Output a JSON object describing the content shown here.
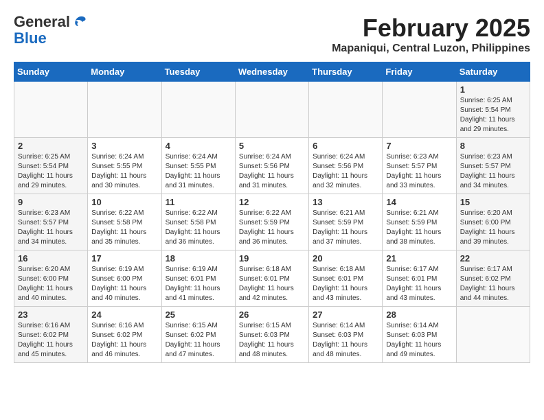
{
  "header": {
    "logo_line1": "General",
    "logo_line2": "Blue",
    "month_year": "February 2025",
    "location": "Mapaniqui, Central Luzon, Philippines"
  },
  "days_of_week": [
    "Sunday",
    "Monday",
    "Tuesday",
    "Wednesday",
    "Thursday",
    "Friday",
    "Saturday"
  ],
  "weeks": [
    [
      {
        "day": "",
        "info": ""
      },
      {
        "day": "",
        "info": ""
      },
      {
        "day": "",
        "info": ""
      },
      {
        "day": "",
        "info": ""
      },
      {
        "day": "",
        "info": ""
      },
      {
        "day": "",
        "info": ""
      },
      {
        "day": "1",
        "info": "Sunrise: 6:25 AM\nSunset: 5:54 PM\nDaylight: 11 hours\nand 29 minutes."
      }
    ],
    [
      {
        "day": "2",
        "info": "Sunrise: 6:25 AM\nSunset: 5:54 PM\nDaylight: 11 hours\nand 29 minutes."
      },
      {
        "day": "3",
        "info": "Sunrise: 6:24 AM\nSunset: 5:55 PM\nDaylight: 11 hours\nand 30 minutes."
      },
      {
        "day": "4",
        "info": "Sunrise: 6:24 AM\nSunset: 5:55 PM\nDaylight: 11 hours\nand 31 minutes."
      },
      {
        "day": "5",
        "info": "Sunrise: 6:24 AM\nSunset: 5:56 PM\nDaylight: 11 hours\nand 31 minutes."
      },
      {
        "day": "6",
        "info": "Sunrise: 6:24 AM\nSunset: 5:56 PM\nDaylight: 11 hours\nand 32 minutes."
      },
      {
        "day": "7",
        "info": "Sunrise: 6:23 AM\nSunset: 5:57 PM\nDaylight: 11 hours\nand 33 minutes."
      },
      {
        "day": "8",
        "info": "Sunrise: 6:23 AM\nSunset: 5:57 PM\nDaylight: 11 hours\nand 34 minutes."
      }
    ],
    [
      {
        "day": "9",
        "info": "Sunrise: 6:23 AM\nSunset: 5:57 PM\nDaylight: 11 hours\nand 34 minutes."
      },
      {
        "day": "10",
        "info": "Sunrise: 6:22 AM\nSunset: 5:58 PM\nDaylight: 11 hours\nand 35 minutes."
      },
      {
        "day": "11",
        "info": "Sunrise: 6:22 AM\nSunset: 5:58 PM\nDaylight: 11 hours\nand 36 minutes."
      },
      {
        "day": "12",
        "info": "Sunrise: 6:22 AM\nSunset: 5:59 PM\nDaylight: 11 hours\nand 36 minutes."
      },
      {
        "day": "13",
        "info": "Sunrise: 6:21 AM\nSunset: 5:59 PM\nDaylight: 11 hours\nand 37 minutes."
      },
      {
        "day": "14",
        "info": "Sunrise: 6:21 AM\nSunset: 5:59 PM\nDaylight: 11 hours\nand 38 minutes."
      },
      {
        "day": "15",
        "info": "Sunrise: 6:20 AM\nSunset: 6:00 PM\nDaylight: 11 hours\nand 39 minutes."
      }
    ],
    [
      {
        "day": "16",
        "info": "Sunrise: 6:20 AM\nSunset: 6:00 PM\nDaylight: 11 hours\nand 40 minutes."
      },
      {
        "day": "17",
        "info": "Sunrise: 6:19 AM\nSunset: 6:00 PM\nDaylight: 11 hours\nand 40 minutes."
      },
      {
        "day": "18",
        "info": "Sunrise: 6:19 AM\nSunset: 6:01 PM\nDaylight: 11 hours\nand 41 minutes."
      },
      {
        "day": "19",
        "info": "Sunrise: 6:18 AM\nSunset: 6:01 PM\nDaylight: 11 hours\nand 42 minutes."
      },
      {
        "day": "20",
        "info": "Sunrise: 6:18 AM\nSunset: 6:01 PM\nDaylight: 11 hours\nand 43 minutes."
      },
      {
        "day": "21",
        "info": "Sunrise: 6:17 AM\nSunset: 6:01 PM\nDaylight: 11 hours\nand 43 minutes."
      },
      {
        "day": "22",
        "info": "Sunrise: 6:17 AM\nSunset: 6:02 PM\nDaylight: 11 hours\nand 44 minutes."
      }
    ],
    [
      {
        "day": "23",
        "info": "Sunrise: 6:16 AM\nSunset: 6:02 PM\nDaylight: 11 hours\nand 45 minutes."
      },
      {
        "day": "24",
        "info": "Sunrise: 6:16 AM\nSunset: 6:02 PM\nDaylight: 11 hours\nand 46 minutes."
      },
      {
        "day": "25",
        "info": "Sunrise: 6:15 AM\nSunset: 6:02 PM\nDaylight: 11 hours\nand 47 minutes."
      },
      {
        "day": "26",
        "info": "Sunrise: 6:15 AM\nSunset: 6:03 PM\nDaylight: 11 hours\nand 48 minutes."
      },
      {
        "day": "27",
        "info": "Sunrise: 6:14 AM\nSunset: 6:03 PM\nDaylight: 11 hours\nand 48 minutes."
      },
      {
        "day": "28",
        "info": "Sunrise: 6:14 AM\nSunset: 6:03 PM\nDaylight: 11 hours\nand 49 minutes."
      },
      {
        "day": "",
        "info": ""
      }
    ]
  ]
}
